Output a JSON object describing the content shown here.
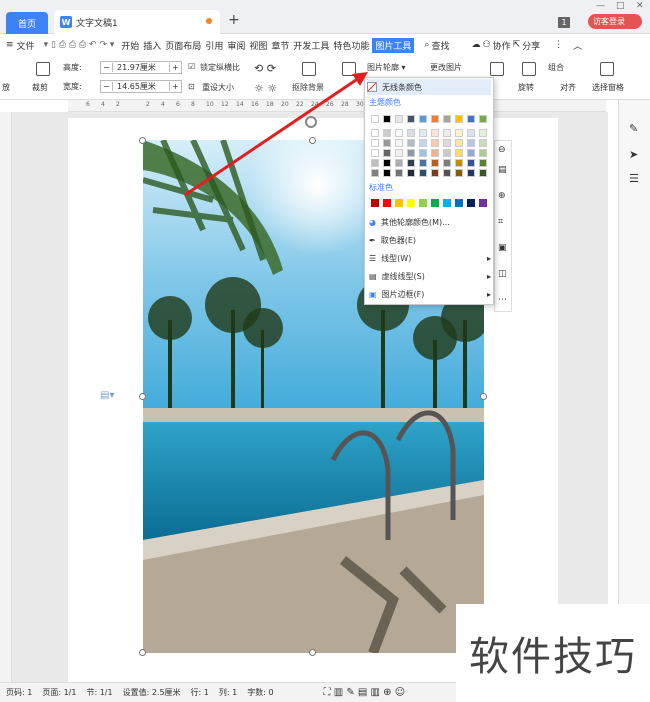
{
  "titlebar": {
    "home_tab": "首页",
    "doc_tab": "文字文稿1",
    "new_tab": "+",
    "page_count": "1",
    "login": "访客登录",
    "minimize": "—",
    "maximize": "□",
    "close": "✕"
  },
  "menubar": {
    "file": "文件",
    "items": [
      "开始",
      "插入",
      "页面布局",
      "引用",
      "审阅",
      "视图",
      "章节",
      "开发工具",
      "特色功能"
    ],
    "active": "图片工具",
    "search": "查找",
    "collab": "协作",
    "share": "分享"
  },
  "ribbon": {
    "height_label": "高度:",
    "height_value": "21.97厘米",
    "width_label": "宽度:",
    "width_value": "14.65厘米",
    "lock_ratio": "锁定纵横比",
    "reset_size": "重设大小",
    "crop": "裁剪",
    "remove_bg": "抠除背景",
    "change_pic": "更改图片",
    "outline": "图片轮廓",
    "rotate": "旋转",
    "align": "对齐",
    "group": "组合",
    "select_pane": "选择窗格",
    "remove_label": "放"
  },
  "ruler": {
    "ticks": [
      "6",
      "4",
      "2",
      "",
      "2",
      "4",
      "6",
      "8",
      "10",
      "12",
      "14",
      "16",
      "18",
      "20",
      "22",
      "24",
      "26",
      "28",
      "30",
      "32",
      "34",
      "36",
      "38",
      "40",
      "42",
      "44",
      "46"
    ]
  },
  "dropdown": {
    "no_line": "无线条颜色",
    "theme_colors": "主题颜色",
    "standard_colors": "标准色",
    "more_colors": "其他轮廓颜色(M)...",
    "eyedropper": "取色器(E)",
    "line_type": "线型(W)",
    "dash_type": "虚线线型(S)",
    "picture_border": "图片边框(F)",
    "theme_top": [
      "#ffffff",
      "#000000",
      "#e7e6e6",
      "#44546a",
      "#5b9bd5",
      "#ed7d31",
      "#a5a5a5",
      "#ffc000",
      "#4472c4",
      "#70ad47"
    ],
    "standard": [
      "#c00000",
      "#ff0000",
      "#ffc000",
      "#ffff00",
      "#92d050",
      "#00b050",
      "#00b0f0",
      "#0070c0",
      "#002060",
      "#7030a0"
    ]
  },
  "statusbar": {
    "page": "页码: 1",
    "pages": "页面: 1/1",
    "section": "节: 1/1",
    "setting": "设置值: 2.5厘米",
    "row": "行: 1",
    "col": "列: 1",
    "words": "字数: 0"
  },
  "watermark": "软件技巧"
}
